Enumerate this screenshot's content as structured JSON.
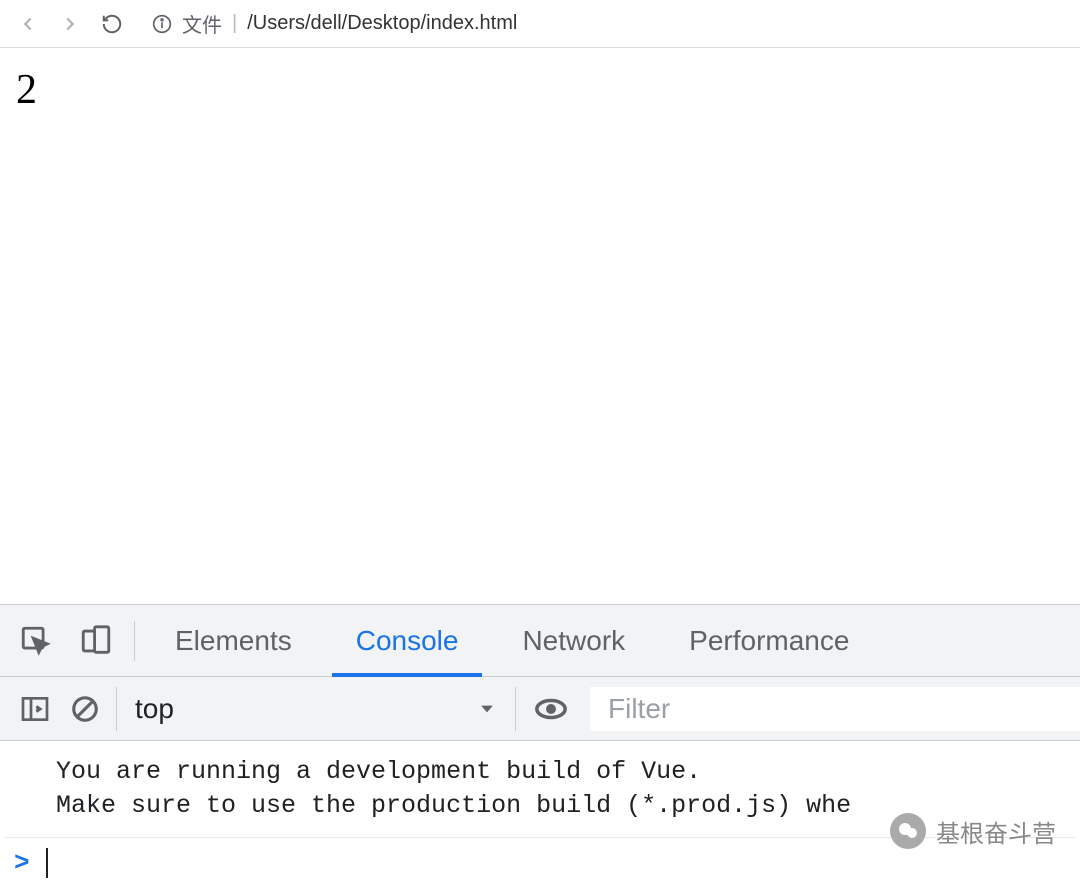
{
  "browser": {
    "protocol_label": "文件",
    "url": "/Users/dell/Desktop/index.html"
  },
  "page": {
    "content_text": "2"
  },
  "devtools": {
    "tabs": {
      "elements": "Elements",
      "console": "Console",
      "network": "Network",
      "performance": "Performance"
    },
    "toolbar": {
      "context": "top",
      "filter_placeholder": "Filter"
    },
    "console": {
      "message": "You are running a development build of Vue.\nMake sure to use the production build (*.prod.js) whe",
      "prompt": ">"
    }
  },
  "watermark": {
    "text": "基根奋斗营"
  }
}
